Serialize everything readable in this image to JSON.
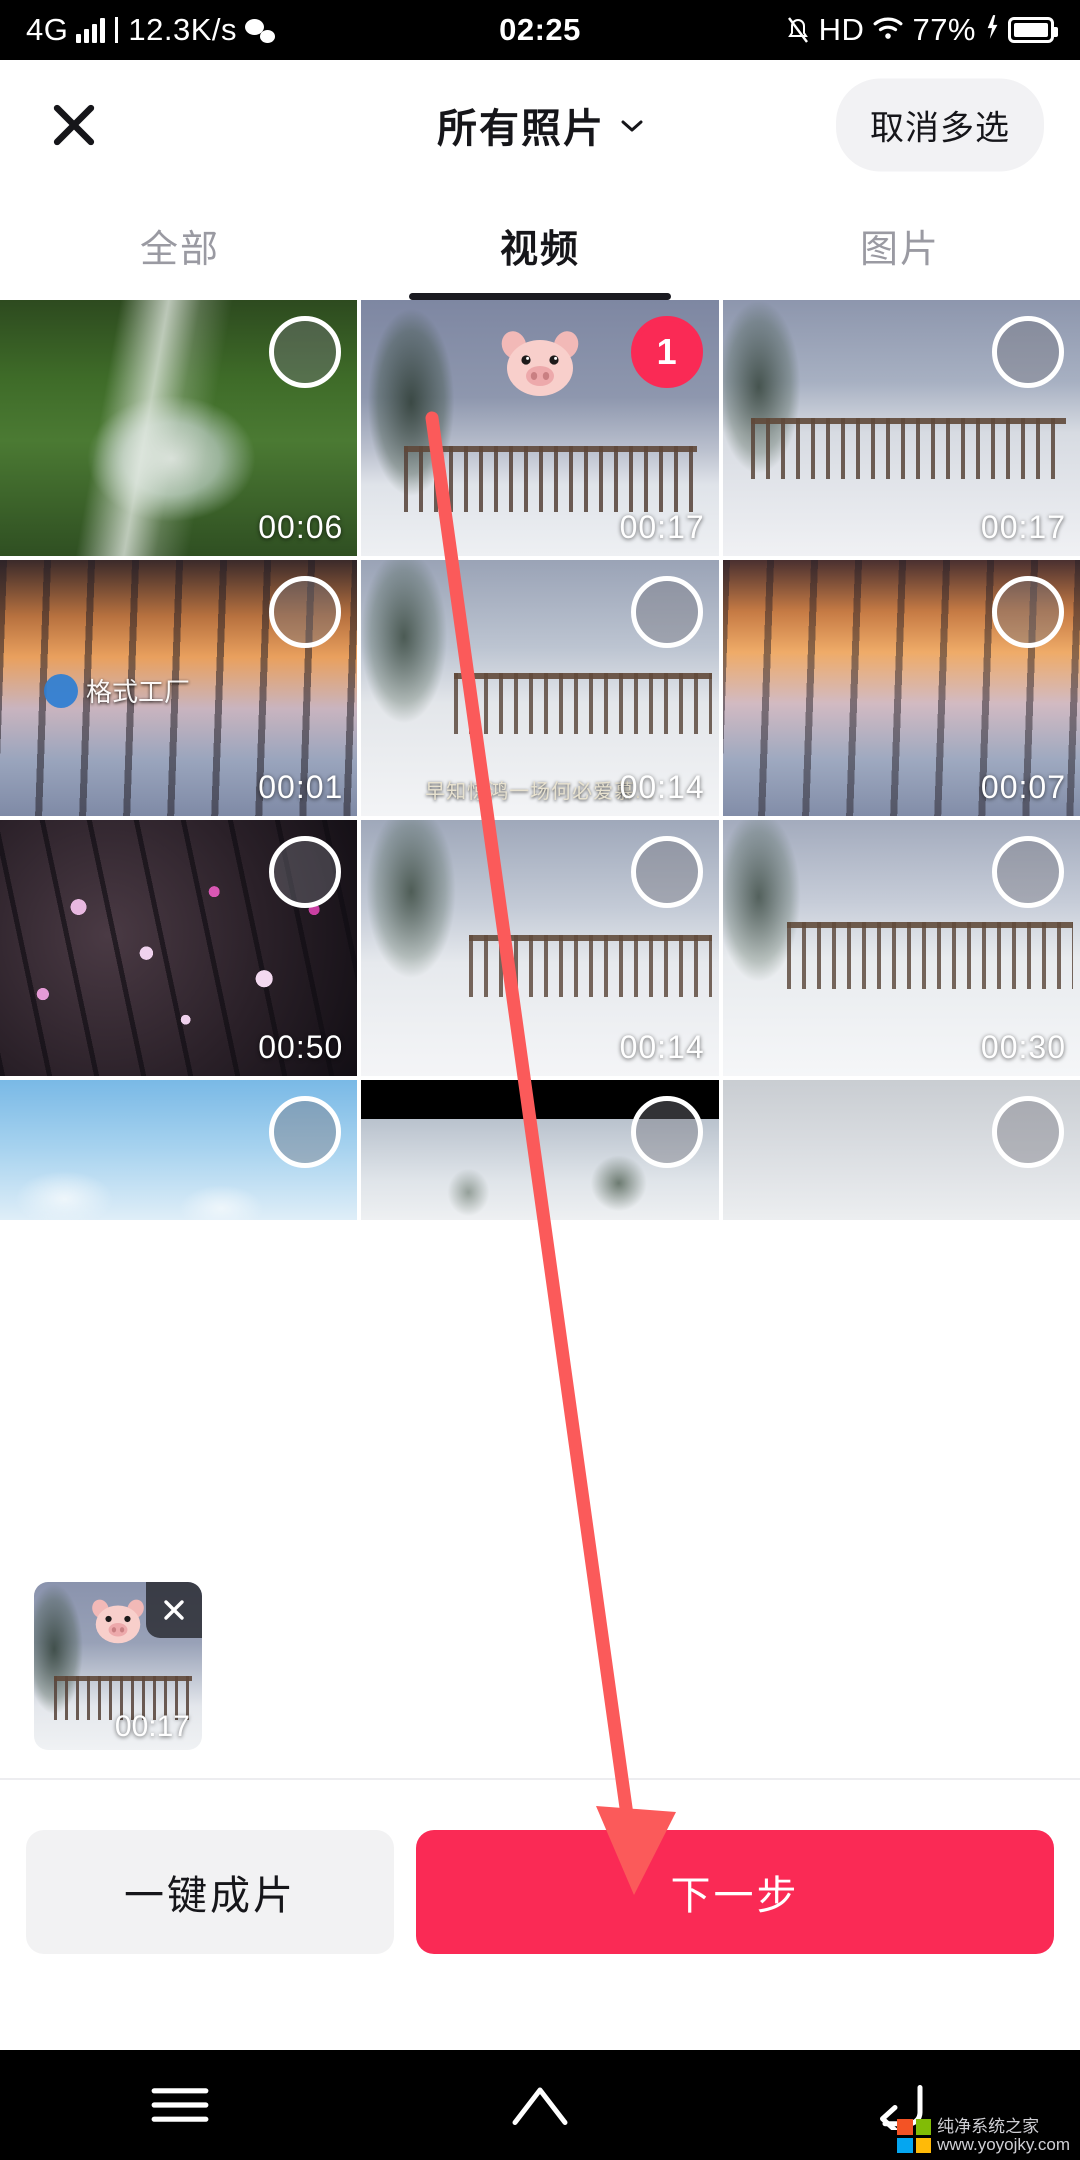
{
  "statusbar": {
    "network": "4G",
    "speed": "12.3K/s",
    "time": "02:25",
    "hd": "HD",
    "battery": "77%",
    "icons": [
      "signal-bars-icon",
      "wechat-icon",
      "mute-icon",
      "hd-icon",
      "wifi-icon",
      "charging-icon",
      "battery-icon"
    ]
  },
  "header": {
    "close_icon": "close-icon",
    "title": "所有照片",
    "chevron_icon": "chevron-down-icon",
    "cancel_label": "取消多选"
  },
  "tabs": [
    {
      "label": "全部",
      "active": false
    },
    {
      "label": "视频",
      "active": true
    },
    {
      "label": "图片",
      "active": false
    }
  ],
  "grid": [
    {
      "duration": "00:06",
      "selected": false,
      "badge": "",
      "art": "waterfall"
    },
    {
      "duration": "00:17",
      "selected": true,
      "badge": "1",
      "art": "snow-bridge-pig"
    },
    {
      "duration": "00:17",
      "selected": false,
      "badge": "",
      "art": "snow-bridge"
    },
    {
      "duration": "00:01",
      "selected": false,
      "badge": "",
      "art": "sunset-trees-watermark"
    },
    {
      "duration": "00:14",
      "selected": false,
      "badge": "",
      "art": "snow-bridge-caption"
    },
    {
      "duration": "00:07",
      "selected": false,
      "badge": "",
      "art": "sunset-trees"
    },
    {
      "duration": "00:50",
      "selected": false,
      "badge": "",
      "art": "plum-blossom"
    },
    {
      "duration": "00:14",
      "selected": false,
      "badge": "",
      "art": "snow-bridge"
    },
    {
      "duration": "00:30",
      "selected": false,
      "badge": "",
      "art": "snow-bridge"
    },
    {
      "duration": "",
      "selected": false,
      "badge": "",
      "art": "birds-sky"
    },
    {
      "duration": "",
      "selected": false,
      "badge": "",
      "art": "snow-letterbox"
    },
    {
      "duration": "",
      "selected": false,
      "badge": "",
      "art": "sky-gray"
    }
  ],
  "watermarks": {
    "格式工厂": "格式工厂",
    "caption": "早知惊鸿一场何必爱慕..."
  },
  "tray": {
    "item": {
      "duration": "00:17",
      "remove_icon": "close-icon"
    }
  },
  "actions": {
    "secondary_label": "一键成片",
    "primary_label": "下一步"
  },
  "navbar": {
    "menu_icon": "menu-icon",
    "home_icon": "home-icon",
    "back_icon": "back-icon"
  },
  "watermark_logo": {
    "line1": "纯净系统之家",
    "line2": "www.yoyojky.com"
  },
  "colors": {
    "accent": "#fa2a55",
    "badge": "#fa2a55",
    "text": "#16161a",
    "muted": "#9a9aa2",
    "chip_bg": "#f2f2f4",
    "arrow": "#fb5a5a"
  }
}
